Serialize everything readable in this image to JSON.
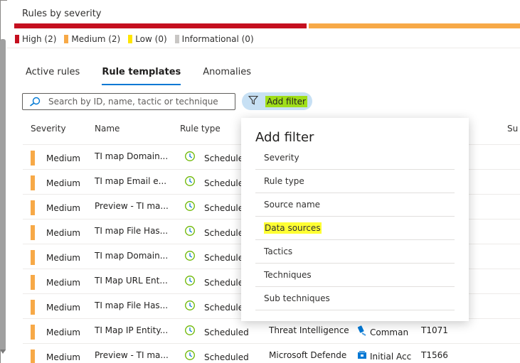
{
  "severity_panel": {
    "title": "Rules by severity",
    "legend": [
      {
        "label": "High (2)",
        "color": "#c50f1f"
      },
      {
        "label": "Medium (2)",
        "color": "#f7a947"
      },
      {
        "label": "Low (0)",
        "color": "#ffe500"
      },
      {
        "label": "Informational (0)",
        "color": "#c8c6c4"
      }
    ]
  },
  "tabs": [
    "Active rules",
    "Rule templates",
    "Anomalies"
  ],
  "active_tab": "Rule templates",
  "search": {
    "placeholder": "Search by ID, name, tactic or technique"
  },
  "add_filter_button": "Add filter",
  "columns": {
    "severity": "Severity",
    "name": "Name",
    "rule_type": "Rule type",
    "sub": "Su"
  },
  "rows": [
    {
      "severity": "Medium",
      "name": "TI map Domain...",
      "type": "Schedule",
      "source": "",
      "tactic": "",
      "technique": ""
    },
    {
      "severity": "Medium",
      "name": "TI map Email e...",
      "type": "Schedule",
      "source": "",
      "tactic": "",
      "technique": ""
    },
    {
      "severity": "Medium",
      "name": "Preview - TI ma...",
      "type": "Schedule",
      "source": "",
      "tactic": "",
      "technique": ""
    },
    {
      "severity": "Medium",
      "name": "TI map File Has...",
      "type": "Schedule",
      "source": "",
      "tactic": "",
      "technique": ""
    },
    {
      "severity": "Medium",
      "name": "TI map Domain...",
      "type": "Schedule",
      "source": "",
      "tactic": "",
      "technique": ""
    },
    {
      "severity": "Medium",
      "name": "TI Map URL Ent...",
      "type": "Schedule",
      "source": "",
      "tactic": "",
      "technique": ""
    },
    {
      "severity": "Medium",
      "name": "TI map File Has...",
      "type": "Schedule",
      "source": "",
      "tactic": "",
      "technique": ""
    },
    {
      "severity": "Medium",
      "name": "TI Map IP Entity...",
      "type": "Scheduled",
      "source": "Threat Intelligence",
      "tactic": "Comman",
      "technique": "T1071"
    },
    {
      "severity": "Medium",
      "name": "Preview - TI ma...",
      "type": "Scheduled",
      "source": "Microsoft Defende",
      "tactic": "Initial Acc",
      "technique": "T1566"
    }
  ],
  "dropdown": {
    "title": "Add filter",
    "items": [
      "Severity",
      "Rule type",
      "Source name",
      "Data sources",
      "Tactics",
      "Techniques",
      "Sub techniques"
    ],
    "highlighted_item": "Data sources"
  }
}
